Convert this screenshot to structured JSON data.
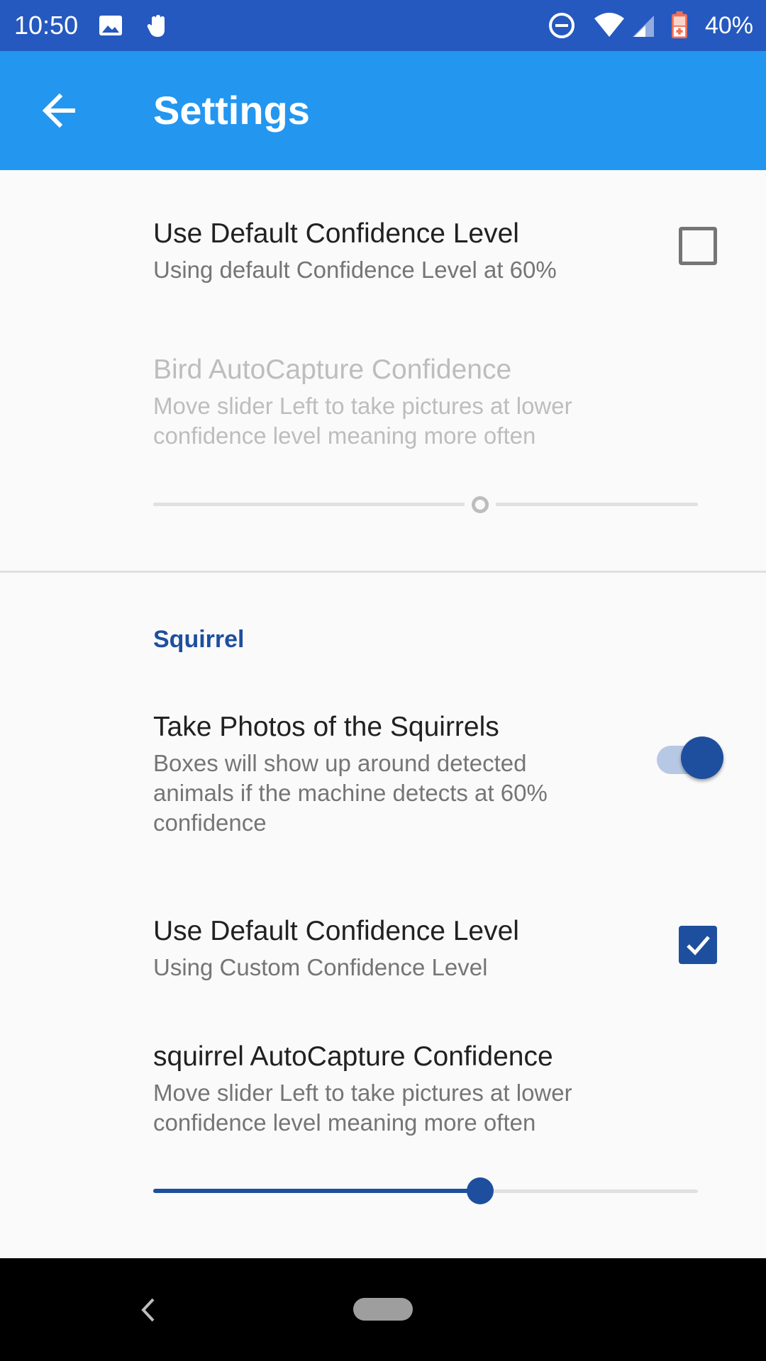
{
  "status_bar": {
    "time": "10:50",
    "battery": "40%",
    "icons": [
      "gallery-icon",
      "gesture-icon",
      "dnd-icon",
      "wifi-icon",
      "cell-signal-icon",
      "battery-icon"
    ]
  },
  "app_bar": {
    "title": "Settings",
    "back_icon": "arrow-left-icon"
  },
  "prefs": {
    "bird_default_confidence": {
      "title": "Use Default Confidence Level",
      "summary": "Using default Confidence Level at 60%",
      "checked": false
    },
    "bird_autocapture": {
      "title": "Bird AutoCapture Confidence",
      "summary": "Move slider Left to take pictures at lower confidence level meaning more often",
      "enabled": false,
      "value": 0.6
    },
    "squirrel_category": "Squirrel",
    "squirrel_photos": {
      "title": "Take Photos of the Squirrels",
      "summary": "Boxes will show up around detected animals if the machine detects at 60% confidence",
      "on": true
    },
    "squirrel_default_confidence": {
      "title": "Use Default Confidence Level",
      "summary": "Using Custom Confidence Level",
      "checked": true
    },
    "squirrel_autocapture": {
      "title": "squirrel AutoCapture Confidence",
      "summary": "Move slider Left to take pictures at lower confidence level meaning more often",
      "enabled": true,
      "value": 0.6
    }
  },
  "colors": {
    "status_bar": "#2559bf",
    "app_bar": "#2396f0",
    "accent": "#1e4f9f"
  }
}
